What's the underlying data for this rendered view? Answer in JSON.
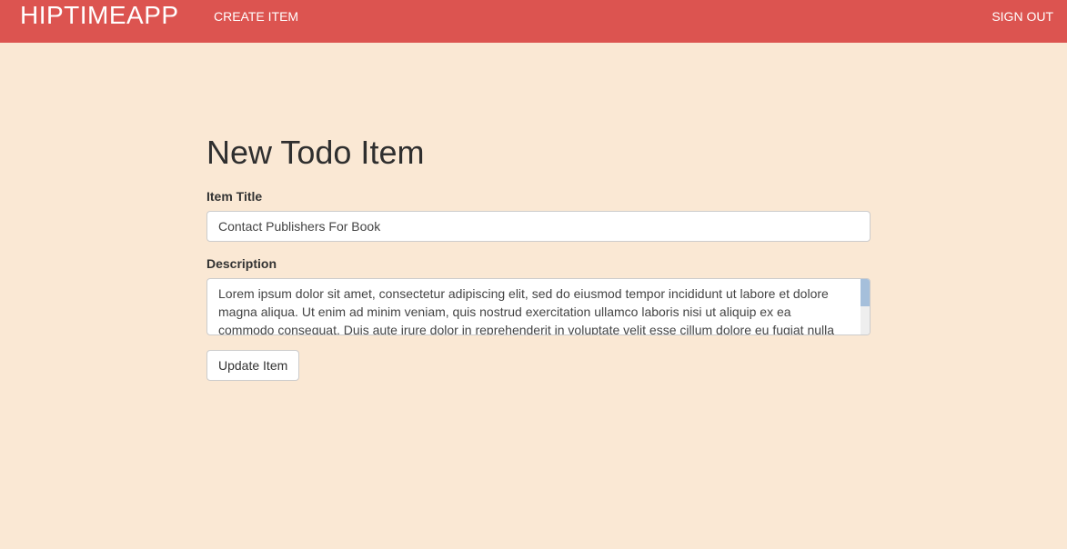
{
  "navbar": {
    "brand": "HIPTIMEAPP",
    "create_item": "CREATE ITEM",
    "sign_out": "SIGN OUT",
    "color": "#dc5450"
  },
  "form": {
    "heading": "New Todo Item",
    "title_label": "Item Title",
    "title_value": "Contact Publishers For Book",
    "description_label": "Description",
    "description_value": "Lorem ipsum dolor sit amet, consectetur adipiscing elit, sed do eiusmod tempor incididunt ut labore et dolore magna aliqua. Ut enim ad minim veniam, quis nostrud exercitation ullamco laboris nisi ut aliquip ex ea commodo consequat. Duis aute irure dolor in reprehenderit in voluptate velit esse cillum dolore eu fugiat nulla pariatur.",
    "submit_label": "Update Item"
  },
  "page": {
    "background": "#fae8d4"
  }
}
